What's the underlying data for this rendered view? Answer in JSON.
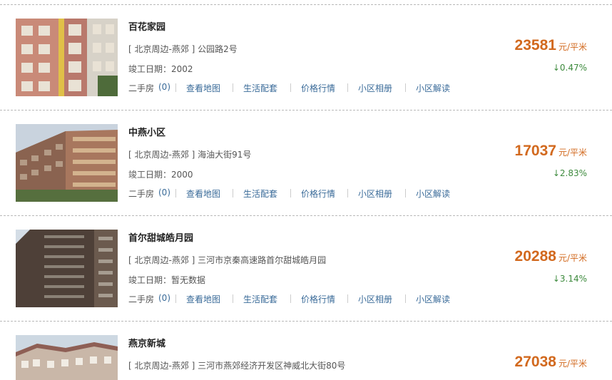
{
  "listings": [
    {
      "name": "百花家园",
      "address": "[ 北京周边-燕郊 ] 公园路2号",
      "built": "竣工日期：2002",
      "secondhand": "二手房",
      "count": "(0)",
      "links": [
        "查看地图",
        "生活配套",
        "价格行情",
        "小区相册",
        "小区解读"
      ],
      "price": "23581",
      "unit": "元/平米",
      "change": "↓0.47%",
      "image": "pink-apartment-building"
    },
    {
      "name": "中燕小区",
      "address": "[ 北京周边-燕郊 ] 海油大街91号",
      "built": "竣工日期：2000",
      "secondhand": "二手房",
      "count": "(0)",
      "links": [
        "查看地图",
        "生活配套",
        "价格行情",
        "小区相册",
        "小区解读"
      ],
      "price": "17037",
      "unit": "元/平米",
      "change": "↓2.83%",
      "image": "residential-blocks"
    },
    {
      "name": "首尔甜城皓月园",
      "address": "[ 北京周边-燕郊 ] 三河市京秦高速路首尔甜城皓月园",
      "built": "竣工日期：暂无数据",
      "secondhand": "二手房",
      "count": "(0)",
      "links": [
        "查看地图",
        "生活配套",
        "价格行情",
        "小区相册",
        "小区解读"
      ],
      "price": "20288",
      "unit": "元/平米",
      "change": "↓3.14%",
      "image": "highrise-tower"
    },
    {
      "name": "燕京新城",
      "address": "[ 北京周边-燕郊 ] 三河市燕郊经济开发区神威北大街80号",
      "price": "27038",
      "unit": "元/平米",
      "image": "low-rise-villas"
    }
  ]
}
